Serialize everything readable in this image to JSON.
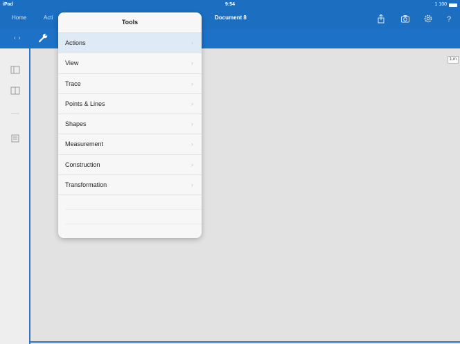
{
  "status_bar": {
    "carrier": "iPad ",
    "time": "9:54",
    "battery_text": "1 100"
  },
  "nav": {
    "home": "Home",
    "actions": "Acti",
    "title": "Document 8"
  },
  "toolbar": {
    "toggle": "‹ ›"
  },
  "canvas": {
    "corner_label": "1.m"
  },
  "popover": {
    "title": "Tools",
    "items": [
      {
        "label": "Actions"
      },
      {
        "label": "View"
      },
      {
        "label": "Trace"
      },
      {
        "label": "Points & Lines"
      },
      {
        "label": "Shapes"
      },
      {
        "label": "Measurement"
      },
      {
        "label": "Construction"
      },
      {
        "label": "Transformation"
      }
    ],
    "chevron": "›"
  },
  "colors": {
    "accent": "#1c6fc0",
    "selected_row": "#dfeaf7"
  }
}
